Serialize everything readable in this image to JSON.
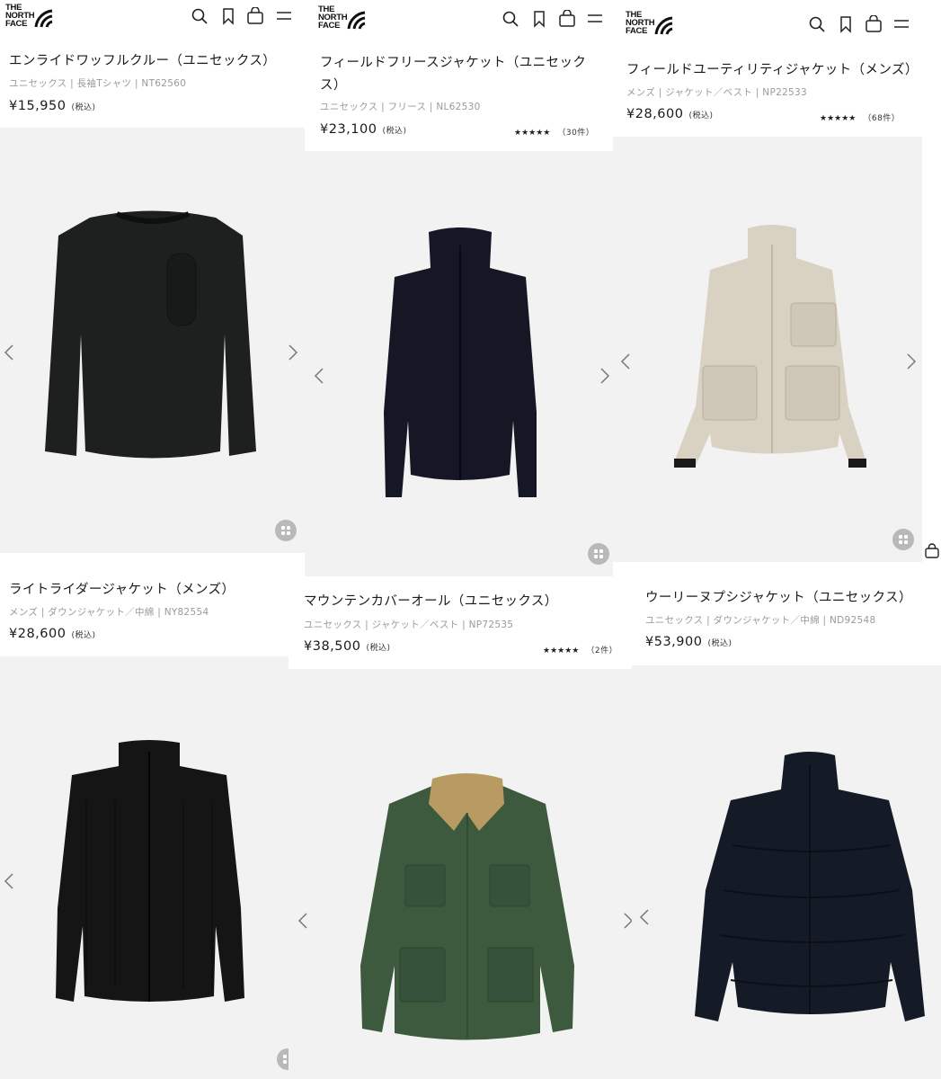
{
  "brand": {
    "logo_text_line1": "THE",
    "logo_text_line2": "NORTH",
    "logo_text_line3": "FACE"
  },
  "header_icons": [
    "search-icon",
    "bookmark-icon",
    "bag-icon",
    "menu-icon"
  ],
  "tax_label": "(税込)",
  "products": [
    {
      "title": "エンライドワッフルクルー（ユニセックス）",
      "meta": "ユニセックス | 長袖Tシャツ | NT62560",
      "price": "¥15,950"
    },
    {
      "title": "フィールドフリースジャケット（ユニセックス）",
      "meta": "ユニセックス | フリース | NL62530",
      "price": "¥23,100",
      "stars": "★★★★★",
      "count": "（30件）"
    },
    {
      "title": "フィールドユーティリティジャケット（メンズ）",
      "meta": "メンズ | ジャケット／ベスト | NP22533",
      "price": "¥28,600",
      "stars": "★★★★★",
      "count": "（68件）"
    },
    {
      "title": "ライトライダージャケット（メンズ）",
      "meta": "メンズ | ダウンジャケット／中綿 | NY82554",
      "price": "¥28,600"
    },
    {
      "title": "マウンテンカバーオール（ユニセックス）",
      "meta": "ユニセックス | ジャケット／ベスト | NP72535",
      "price": "¥38,500",
      "stars": "★★★★★",
      "count": "（2件）"
    },
    {
      "title": "ウーリーヌプシジャケット（ユニセックス）",
      "meta": "ユニセックス | ダウンジャケット／中綿 | ND92548",
      "price": "¥53,900"
    }
  ],
  "colors": {
    "panel_bg": "#f2f2f2",
    "quick_btn": "#b9b9b9",
    "text": "#1a1a1a",
    "meta": "#9a9a9a"
  }
}
